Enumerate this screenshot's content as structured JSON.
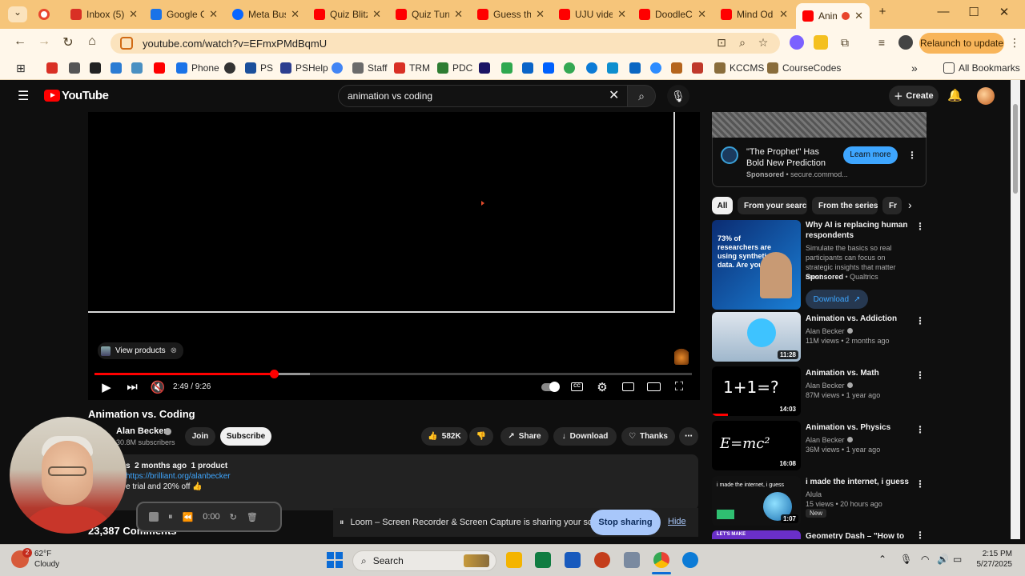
{
  "browser": {
    "tabs": [
      {
        "title": "",
        "icon": "record-icon",
        "color": "#e8452c"
      },
      {
        "title": "Inbox (5)",
        "icon": "gmail-icon",
        "color": "#d93025"
      },
      {
        "title": "Google C",
        "icon": "google-docs-icon",
        "color": "#1a73e8"
      },
      {
        "title": "Meta Bus",
        "icon": "meta-icon",
        "color": "#0866ff"
      },
      {
        "title": "Quiz Blitz",
        "icon": "youtube-icon",
        "color": "#ff0000"
      },
      {
        "title": "Quiz Turn",
        "icon": "youtube-icon",
        "color": "#ff0000"
      },
      {
        "title": "Guess th",
        "icon": "youtube-icon",
        "color": "#ff0000"
      },
      {
        "title": "UJU vide",
        "icon": "youtube-icon",
        "color": "#ff0000"
      },
      {
        "title": "DoodleC",
        "icon": "youtube-icon",
        "color": "#ff0000"
      },
      {
        "title": "Mind Od",
        "icon": "youtube-icon",
        "color": "#ff0000"
      },
      {
        "title": "Anim",
        "icon": "youtube-icon",
        "color": "#ff0000"
      }
    ],
    "new_tab": "+",
    "url": "youtube.com/watch?v=EFmxPMdBqmU",
    "relaunch_label": "Relaunch to update",
    "bookmarks": [
      {
        "label": "Phone",
        "color": "#1a73e8"
      },
      {
        "label": "PS",
        "color": "#1a4f9c"
      },
      {
        "label": "PSHelp",
        "color": "#2c3e8f"
      },
      {
        "label": "Staff",
        "color": "#6b6b6b"
      },
      {
        "label": "TRM",
        "color": "#d93025"
      },
      {
        "label": "PDC",
        "color": "#2e7d32"
      },
      {
        "label": "KCCMS",
        "color": "#8a6d3b"
      },
      {
        "label": "CourseCodes",
        "color": "#8a6d3b"
      }
    ],
    "all_bookmarks_label": "All Bookmarks"
  },
  "youtube": {
    "logo_text": "YouTube",
    "search_value": "animation vs coding",
    "create_label": "Create",
    "player": {
      "view_products_label": "View products",
      "time": "2:49 / 9:26",
      "progress_played": 0.3,
      "progress_buffered": 0.36
    },
    "video": {
      "title": "Animation vs. Coding",
      "channel": "Alan Becker",
      "subscribers": "30.8M subscribers",
      "join_label": "Join",
      "subscribe_label": "Subscribe",
      "likes": "582K",
      "share_label": "Share",
      "download_label": "Download",
      "thanks_label": "Thanks",
      "description_meta": "s  2 months ago  1 product",
      "description_link": "https://brilliant.org/alanbecker",
      "description_line": "e trial and 20% off 👍",
      "comments": "23,387 Comments"
    },
    "ad": {
      "title": "\"The Prophet\" Has Bold New Prediction",
      "sponsored": "Sponsored",
      "domain": "secure.commod...",
      "learn_more": "Learn more"
    },
    "chips": [
      "All",
      "From your search",
      "From the series",
      "Fr"
    ],
    "recommendations": [
      {
        "title": "Why AI is replacing human respondents",
        "channel": "Simulate the basics so real participants can focus on strategic insights that matter most.",
        "meta_bold": "Sponsored",
        "meta": "Qualtrics",
        "button": "Download",
        "thumb_text": "73% of researchers are using synthetic data. Are you?",
        "duration": ""
      },
      {
        "title": "Animation vs. Addiction",
        "channel": "Alan Becker",
        "meta": "11M views • 2 months ago",
        "duration": "11:28"
      },
      {
        "title": "Animation vs. Math",
        "channel": "Alan Becker",
        "meta": "87M views • 1 year ago",
        "duration": "14:03",
        "thumb_text": "1+1=?"
      },
      {
        "title": "Animation vs. Physics",
        "channel": "Alan Becker",
        "meta": "36M views • 1 year ago",
        "duration": "16:08",
        "thumb_text": "E=mc²"
      },
      {
        "title": "i made the internet, i guess",
        "channel": "Alula",
        "meta": "15 views • 20 hours ago",
        "badge": "New",
        "duration": "1:07",
        "thumb_text": "i made the internet, i guess"
      },
      {
        "title": "Geometry Dash – \"How to make",
        "channel": "",
        "meta": "",
        "duration": "",
        "thumb_text": "LET'S MAKE"
      }
    ]
  },
  "loom": {
    "timer": "0:00",
    "banner_text": "Loom – Screen Recorder & Screen Capture is sharing your screen.",
    "stop_sharing": "Stop sharing",
    "hide": "Hide"
  },
  "taskbar": {
    "notification_count": "2",
    "temp": "62°F",
    "weather": "Cloudy",
    "search_label": "Search",
    "time": "2:15 PM",
    "date": "5/27/2025"
  }
}
